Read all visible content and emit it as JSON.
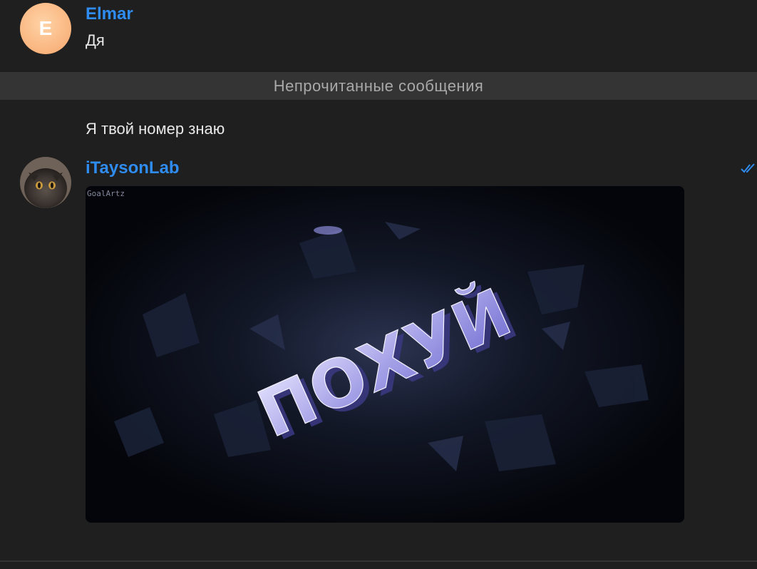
{
  "messages": [
    {
      "sender": "Elmar",
      "avatar_letter": "E",
      "text": "Дя"
    }
  ],
  "unread_divider": "Непрочитанные сообщения",
  "continuation_text": "Я твой номер знаю",
  "second_message": {
    "sender": "iTaysonLab",
    "avatar_icon": "cat-avatar-icon",
    "media_watermark": "GoalArtz",
    "media_word": "ПОХУЙ",
    "status_icon": "double-check-icon"
  },
  "colors": {
    "background": "#1f1f1f",
    "sender_name": "#2f8cf0",
    "divider_bg": "#343434",
    "divider_text": "#a9a9a9"
  }
}
